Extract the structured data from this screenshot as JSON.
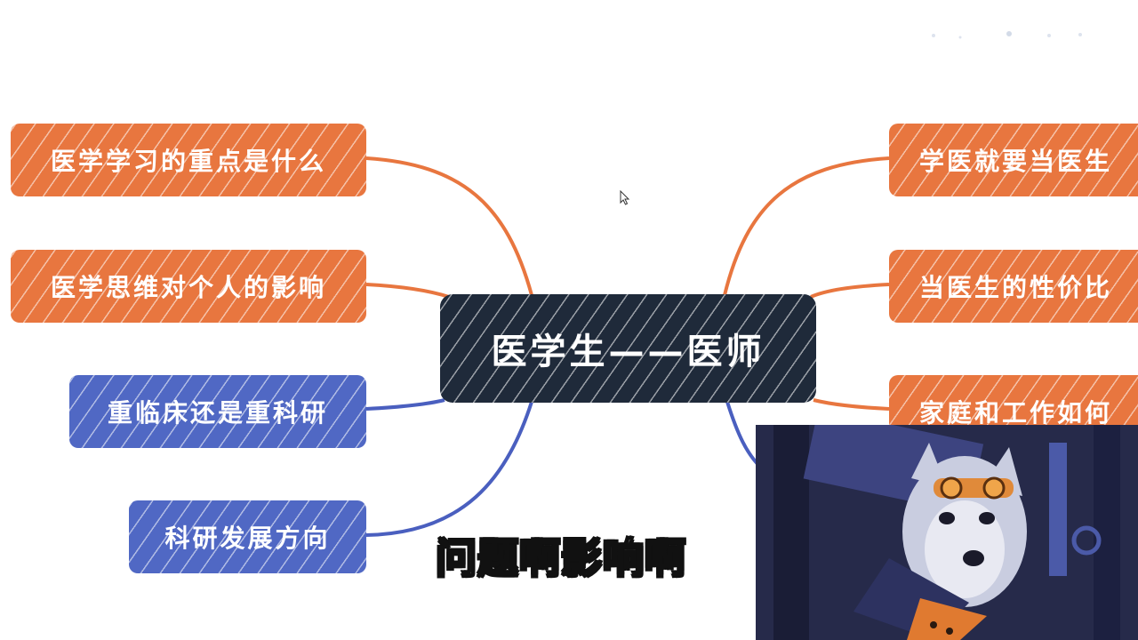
{
  "mindmap": {
    "center": "医学生——医师",
    "left_nodes": [
      {
        "label": "医学学习的重点是什么",
        "color": "orange"
      },
      {
        "label": "医学思维对个人的影响",
        "color": "orange"
      },
      {
        "label": "重临床还是重科研",
        "color": "blue"
      },
      {
        "label": "科研发展方向",
        "color": "blue"
      }
    ],
    "right_nodes": [
      {
        "label": "学医就要当医生",
        "color": "orange"
      },
      {
        "label": "当医生的性价比",
        "color": "orange"
      },
      {
        "label": "家庭和工作如何",
        "color": "orange"
      }
    ]
  },
  "subtitle": "问题啊影响啊",
  "colors": {
    "orange": "#e8763f",
    "blue": "#5068c4",
    "center": "#1f2a3a",
    "line_orange": "#e8763f",
    "line_blue": "#4a5fbf"
  },
  "icons": {
    "cursor": "mouse-pointer-icon",
    "overlay": "webcam-overlay-image"
  }
}
